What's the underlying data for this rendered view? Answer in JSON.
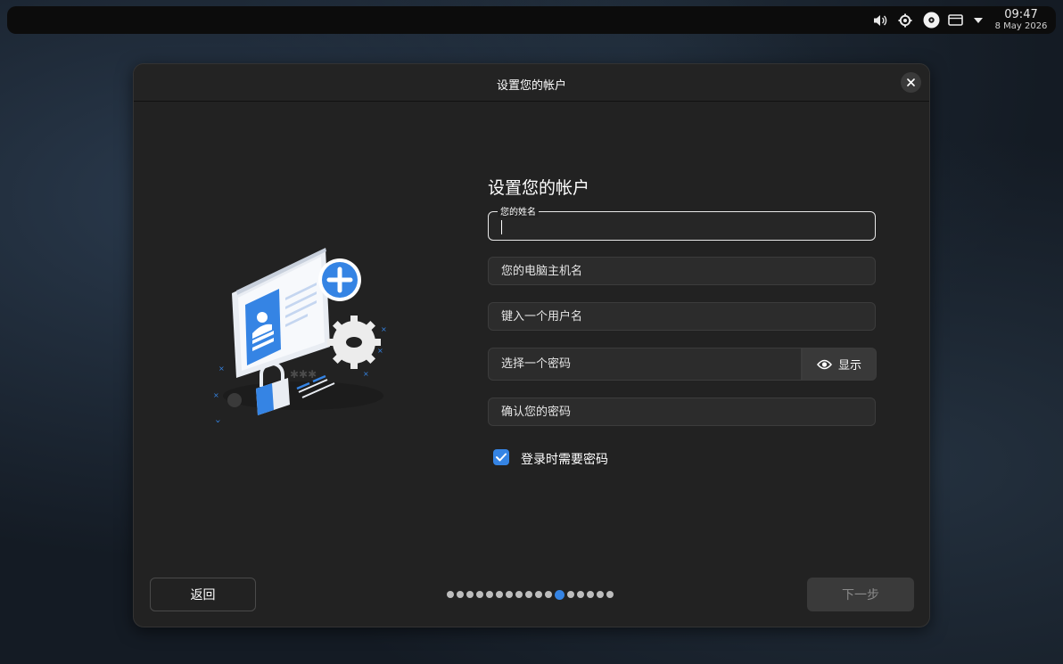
{
  "topbar": {
    "icons": [
      "volume-icon",
      "settings-icon",
      "disc-icon",
      "display-icon",
      "dropdown-icon"
    ],
    "time": "09:47",
    "date": "8 May 2026"
  },
  "dialog": {
    "header_title": "设置您的帐户",
    "form_title": "设置您的帐户",
    "name_label": "您的姓名",
    "hostname_placeholder": "您的电脑主机名",
    "username_placeholder": "键入一个用户名",
    "password_placeholder": "选择一个密码",
    "reveal_label": "显示",
    "confirm_placeholder": "确认您的密码",
    "require_password_label": "登录时需要密码",
    "require_password_checked": true,
    "back_label": "返回",
    "next_label": "下一步",
    "page_total": 17,
    "page_current": 12
  },
  "colors": {
    "accent": "#3584e4",
    "surface": "#222222",
    "field_bg": "#2c2c2c"
  }
}
